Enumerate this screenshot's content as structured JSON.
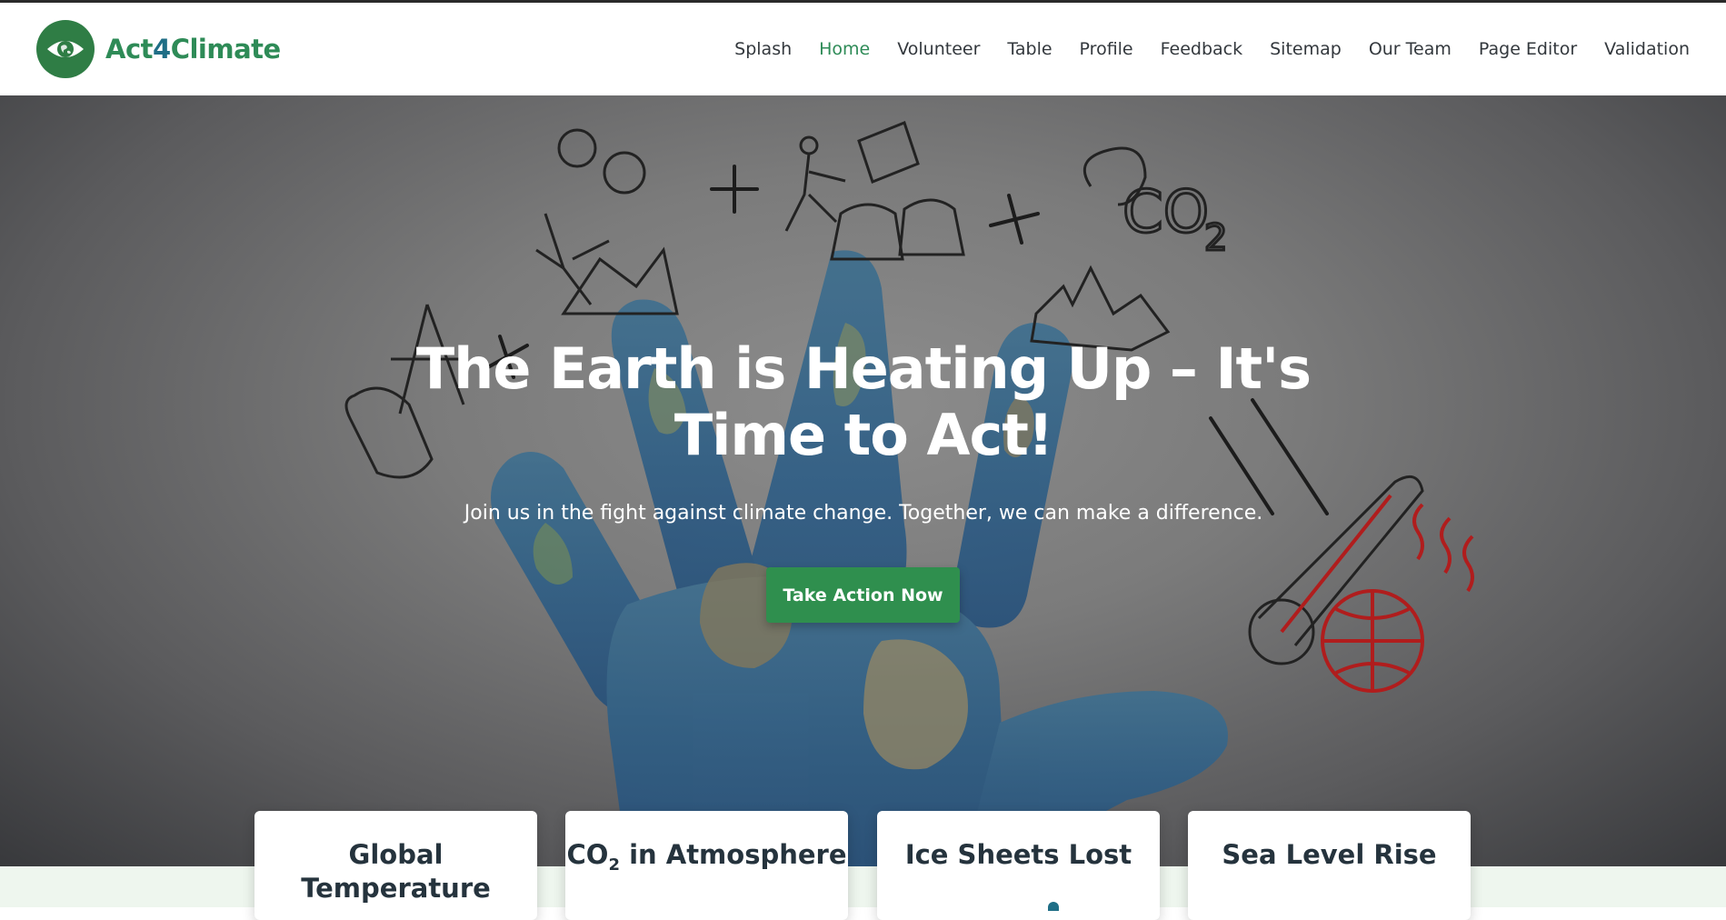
{
  "brand": {
    "prefix": "Act",
    "number": "4",
    "suffix": "Climate",
    "logo_icon": "eye-globe-icon"
  },
  "colors": {
    "brand_green": "#2e8b57",
    "button_green": "#2f8f4e",
    "active_nav": "#2e8b57"
  },
  "nav": {
    "items": [
      {
        "label": "Splash",
        "active": false
      },
      {
        "label": "Home",
        "active": true
      },
      {
        "label": "Volunteer",
        "active": false
      },
      {
        "label": "Table",
        "active": false
      },
      {
        "label": "Profile",
        "active": false
      },
      {
        "label": "Feedback",
        "active": false
      },
      {
        "label": "Sitemap",
        "active": false
      },
      {
        "label": "Our Team",
        "active": false
      },
      {
        "label": "Page Editor",
        "active": false
      },
      {
        "label": "Validation",
        "active": false
      }
    ]
  },
  "hero": {
    "title": "The Earth is Heating Up – It's Time to Act!",
    "subtitle": "Join us in the fight against climate change. Together, we can make a difference.",
    "cta_label": "Take Action Now",
    "image_icon": "earth-hand-climate-doodle-image"
  },
  "stats": {
    "cards": [
      {
        "title": "Global Temperature"
      },
      {
        "title_pre": "CO",
        "title_sub": "2",
        "title_post": " in Atmosphere"
      },
      {
        "title": "Ice Sheets Lost"
      },
      {
        "title": "Sea Level Rise"
      }
    ]
  }
}
